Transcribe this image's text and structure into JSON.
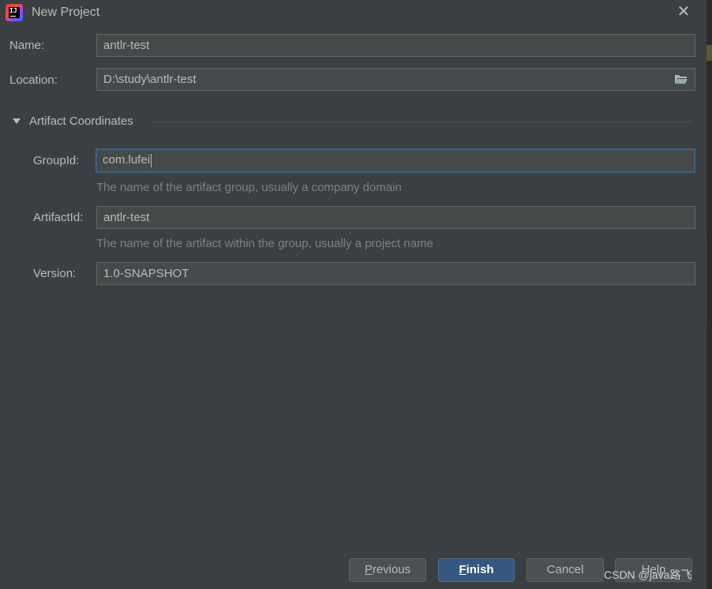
{
  "window": {
    "title": "New Project"
  },
  "form": {
    "name_label": "Name:",
    "name_value": "antlr-test",
    "location_label": "Location:",
    "location_value": "D:\\study\\antlr-test"
  },
  "artifact": {
    "section_title": "Artifact Coordinates",
    "groupid_label": "GroupId:",
    "groupid_value": "com.lufei",
    "groupid_hint": "The name of the artifact group, usually a company domain",
    "artifactid_label": "ArtifactId:",
    "artifactid_value": "antlr-test",
    "artifactid_hint": "The name of the artifact within the group, usually a project name",
    "version_label": "Version:",
    "version_value": "1.0-SNAPSHOT"
  },
  "buttons": {
    "previous_mnemonic": "P",
    "previous_rest": "revious",
    "finish_mnemonic": "F",
    "finish_rest": "inish",
    "cancel": "Cancel",
    "help": "Help"
  },
  "watermark": "CSDN @java路飞",
  "colors": {
    "background": "#3c3f41",
    "field": "#45494a",
    "focus_border": "#3d6185",
    "primary_button": "#365880"
  }
}
